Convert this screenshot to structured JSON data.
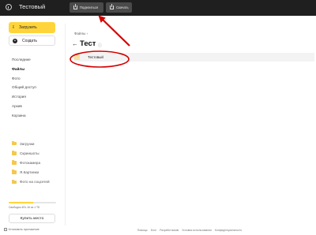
{
  "header": {
    "title": "Тестовый",
    "share_label": "Поделиться",
    "download_label": "Скачать"
  },
  "sidebar": {
    "upload_label": "Загрузить",
    "create_label": "Создать",
    "nav": [
      {
        "label": "Последние",
        "active": false
      },
      {
        "label": "Файлы",
        "active": true
      },
      {
        "label": "Фото",
        "active": false
      },
      {
        "label": "Общий доступ",
        "active": false
      },
      {
        "label": "История",
        "active": false
      },
      {
        "label": "Архив",
        "active": false
      },
      {
        "label": "Корзина",
        "active": false
      }
    ],
    "folders": [
      {
        "label": "Загрузки"
      },
      {
        "label": "Скриншоты"
      },
      {
        "label": "Фотокамера"
      },
      {
        "label": "Я.Картинки"
      },
      {
        "label": "Фото на соцсетей"
      }
    ],
    "storage": {
      "text": "Свободно 491.16 из 1 ТБ",
      "used_fraction": 0.52
    },
    "buy_label": "Купить место",
    "install_label": "Установить приложение"
  },
  "main": {
    "breadcrumb": "Файлы",
    "breadcrumb_separator": "›",
    "back_glyph": "←",
    "folder_title": "Тест",
    "info_glyph": "ⓘ",
    "file_name": "Тестовый"
  },
  "footer": {
    "links": [
      "Помощь",
      "Блог",
      "Разработчикам",
      "Условия использования",
      "Конфиденциальность"
    ]
  },
  "colors": {
    "topbar": "#1f1f1f",
    "accent_yellow": "#ffd43b",
    "annotation_red": "#d40000"
  },
  "icons": {
    "logo": "app-logo-icon",
    "share": "share-icon",
    "download": "download-icon",
    "upload": "upload-arrow-icon",
    "create": "plus-circle-icon",
    "folder": "folder-icon",
    "info": "info-icon",
    "back": "back-arrow-icon",
    "phone": "phone-icon"
  }
}
